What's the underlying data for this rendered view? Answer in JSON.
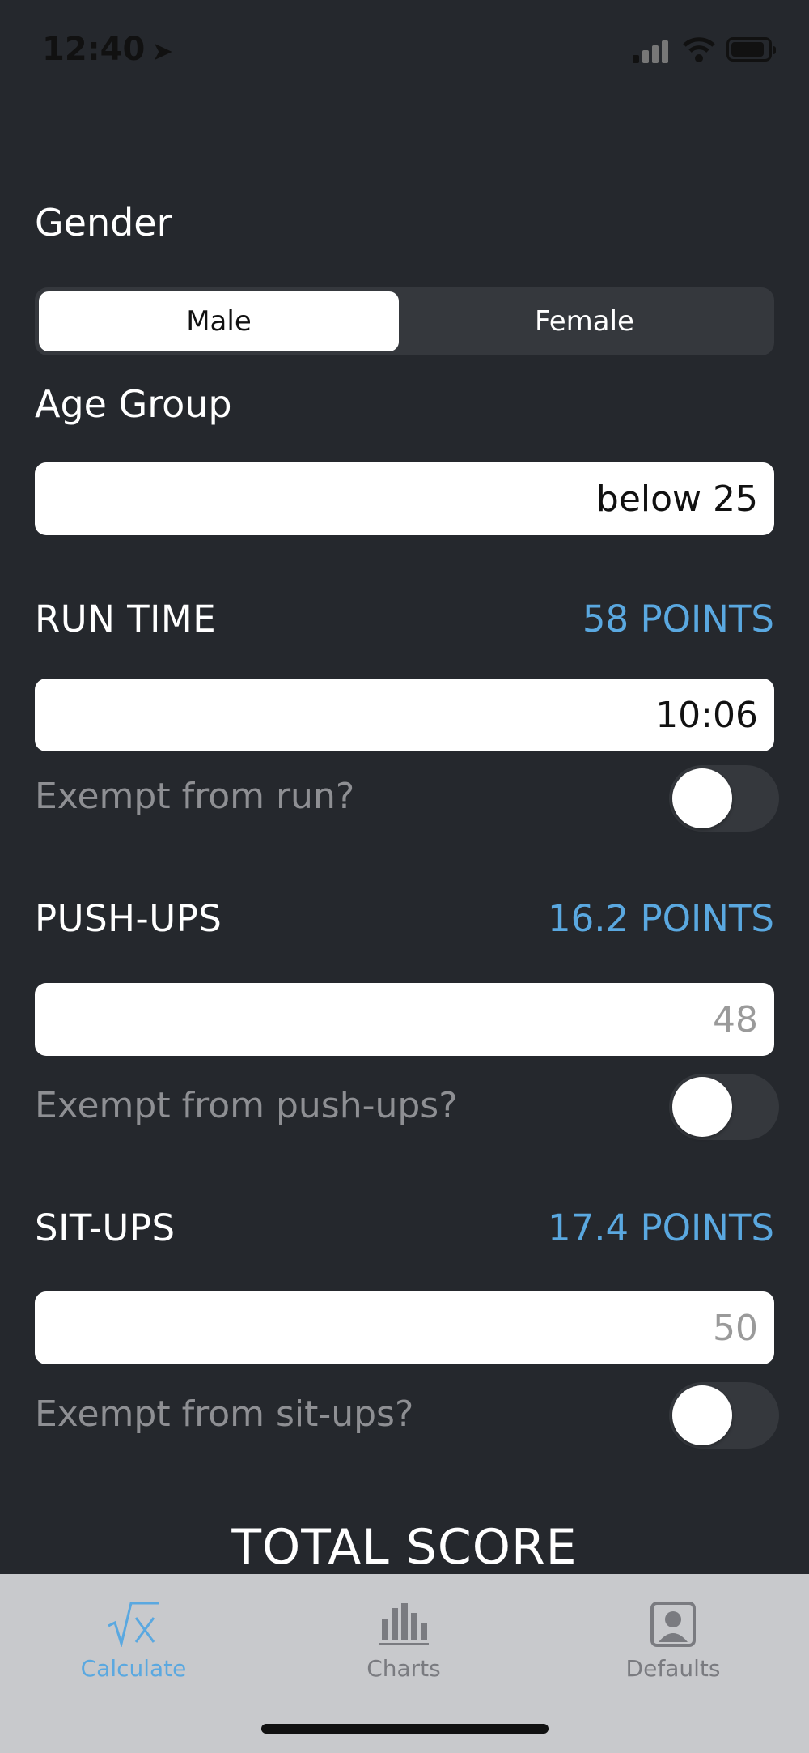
{
  "status": {
    "time": "12:40",
    "location_icon": "location-arrow-icon"
  },
  "form": {
    "gender_label": "Gender",
    "gender_options": [
      "Male",
      "Female"
    ],
    "gender_selected": "Male",
    "age_label": "Age Group",
    "age_value": "below 25",
    "run": {
      "title": "RUN TIME",
      "points": "58 POINTS",
      "value": "10:06",
      "exempt_label": "Exempt from run?",
      "exempt": false
    },
    "pushups": {
      "title": "PUSH-UPS",
      "points": "16.2 POINTS",
      "placeholder": "48",
      "exempt_label": "Exempt from push-ups?",
      "exempt": false
    },
    "situps": {
      "title": "SIT-UPS",
      "points": "17.4 POINTS",
      "placeholder": "50",
      "exempt_label": "Exempt from sit-ups?",
      "exempt": false
    },
    "total_label": "TOTAL SCORE"
  },
  "tabs": [
    {
      "label": "Calculate",
      "icon": "square-root-icon",
      "active": true
    },
    {
      "label": "Charts",
      "icon": "bar-chart-icon",
      "active": false
    },
    {
      "label": "Defaults",
      "icon": "profile-icon",
      "active": false
    }
  ],
  "colors": {
    "background": "#25282d",
    "accent": "#5aa8e0",
    "tabbar": "#c8c9cc"
  }
}
